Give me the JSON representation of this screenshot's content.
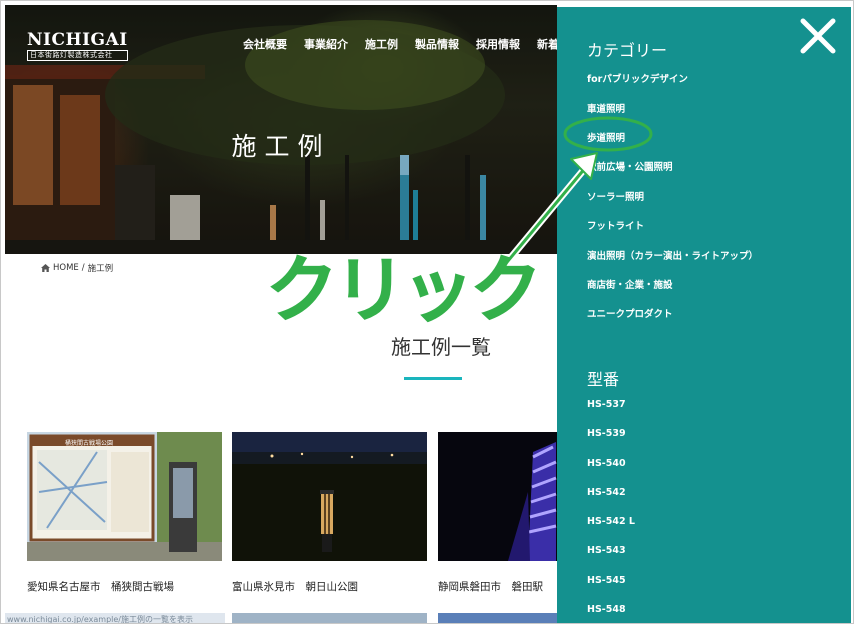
{
  "site": {
    "logo_main": "NICHIGAI",
    "logo_sub": "日本街路灯製造株式会社"
  },
  "nav": [
    "会社概要",
    "事業紹介",
    "施工例",
    "製品情報",
    "採用情報",
    "新着"
  ],
  "hero": {
    "title": "施工例"
  },
  "breadcrumb": {
    "home": "HOME",
    "separator": "/",
    "current": "施工例"
  },
  "section": {
    "title": "施工例一覧"
  },
  "cards": [
    {
      "caption": "愛知県名古屋市　桶狭間古戦場",
      "sign_text": "桶狭間古戦場公園"
    },
    {
      "caption": "富山県氷見市　朝日山公園"
    },
    {
      "caption": "静岡県磐田市　磐田駅"
    }
  ],
  "status_bar": {
    "url": "www.nichigai.co.jp/example/施工例の一覧を表示"
  },
  "panel": {
    "close_icon": "close-icon",
    "category_heading": "カテゴリー",
    "categories": [
      "forパブリックデザイン",
      "車道照明",
      "歩道照明",
      "駅前広場・公園照明",
      "ソーラー照明",
      "フットライト",
      "演出照明（カラー演出・ライトアップ）",
      "商店街・企業・施設",
      "ユニークプロダクト"
    ],
    "model_heading": "型番",
    "models": [
      "HS-537",
      "HS-539",
      "HS-540",
      "HS-542",
      "HS-542 L",
      "HS-543",
      "HS-545",
      "HS-548"
    ]
  },
  "annotation": {
    "text": "クリック",
    "color": "#33b04a"
  },
  "colors": {
    "panel_bg": "#14918f",
    "accent_line": "#1ab5bd"
  }
}
